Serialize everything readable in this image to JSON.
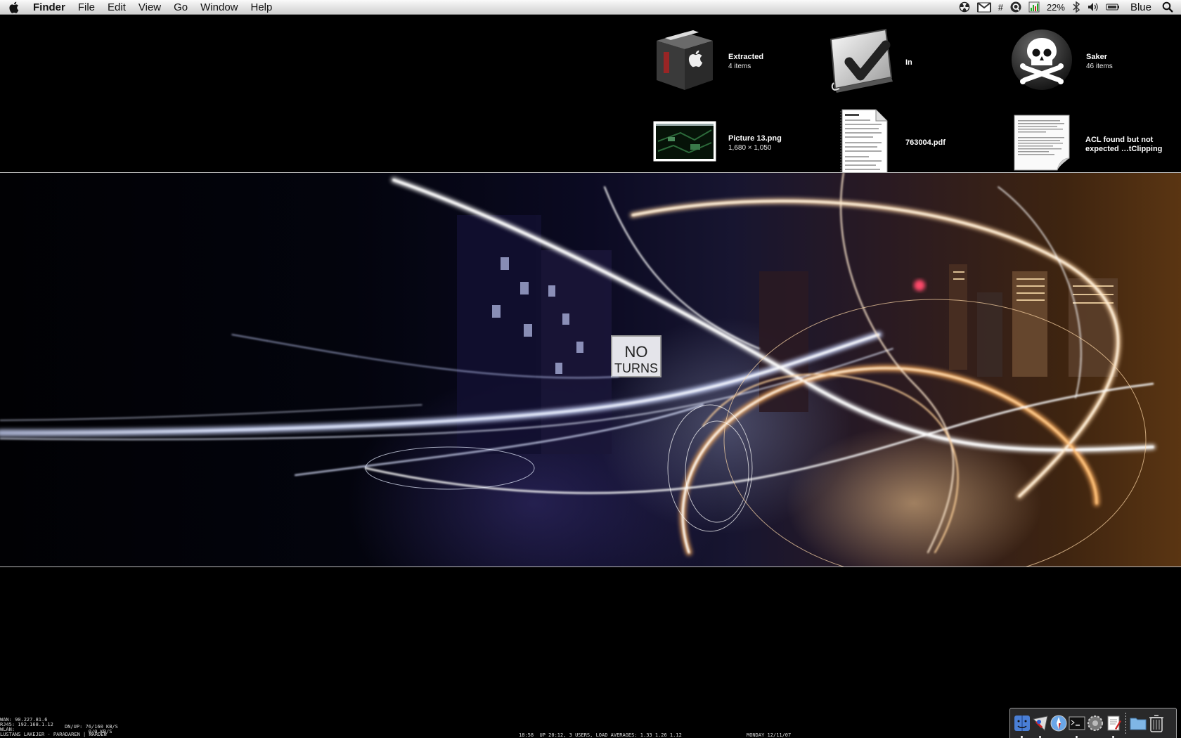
{
  "menubar": {
    "app_name": "Finder",
    "menus": [
      "File",
      "Edit",
      "View",
      "Go",
      "Window",
      "Help"
    ],
    "status": {
      "cpu_percent": "22%",
      "user": "Blue",
      "hash_glyph": "#"
    }
  },
  "desktop": {
    "items": [
      {
        "name": "Extracted",
        "sub": "4 items",
        "icon": "box-icon"
      },
      {
        "name": "In",
        "sub": "",
        "icon": "checkmark-folder-icon"
      },
      {
        "name": "Saker",
        "sub": "46 items",
        "icon": "skull-icon"
      },
      {
        "name": "Picture 13.png",
        "sub": "1,680 × 1,050",
        "icon": "image-thumbnail-icon"
      },
      {
        "name": "763004.pdf",
        "sub": "",
        "icon": "pdf-document-icon"
      },
      {
        "name": "ACL found but not expected …tClipping",
        "sub": "",
        "icon": "text-clipping-icon"
      }
    ]
  },
  "wallpaper": {
    "sign_line1": "NO",
    "sign_line2": "TURNS"
  },
  "geektool": {
    "net": "WAN: 90.227.81.6\nRJ45: 192.168.1.12\nWLAN:\nLUSTANS LAKEJER - PARADAREN | NARDEN",
    "traffic": "DN/UP: 76/160 KB/S\n        0/0 KB/S",
    "uptime": "18:58  UP 20:12, 3 USERS, LOAD AVERAGES: 1.33 1.26 1.12",
    "date": "MONDAY 12/11/07"
  },
  "dock": {
    "items": [
      "finder-icon",
      "mail-icon",
      "safari-icon",
      "terminal-icon",
      "system-preferences-icon",
      "textedit-icon",
      "folder-icon",
      "trash-icon"
    ]
  },
  "colors": {
    "menubar_top": "#fafafa",
    "menubar_bottom": "#d0d0d0",
    "desktop_bg": "#000000"
  }
}
